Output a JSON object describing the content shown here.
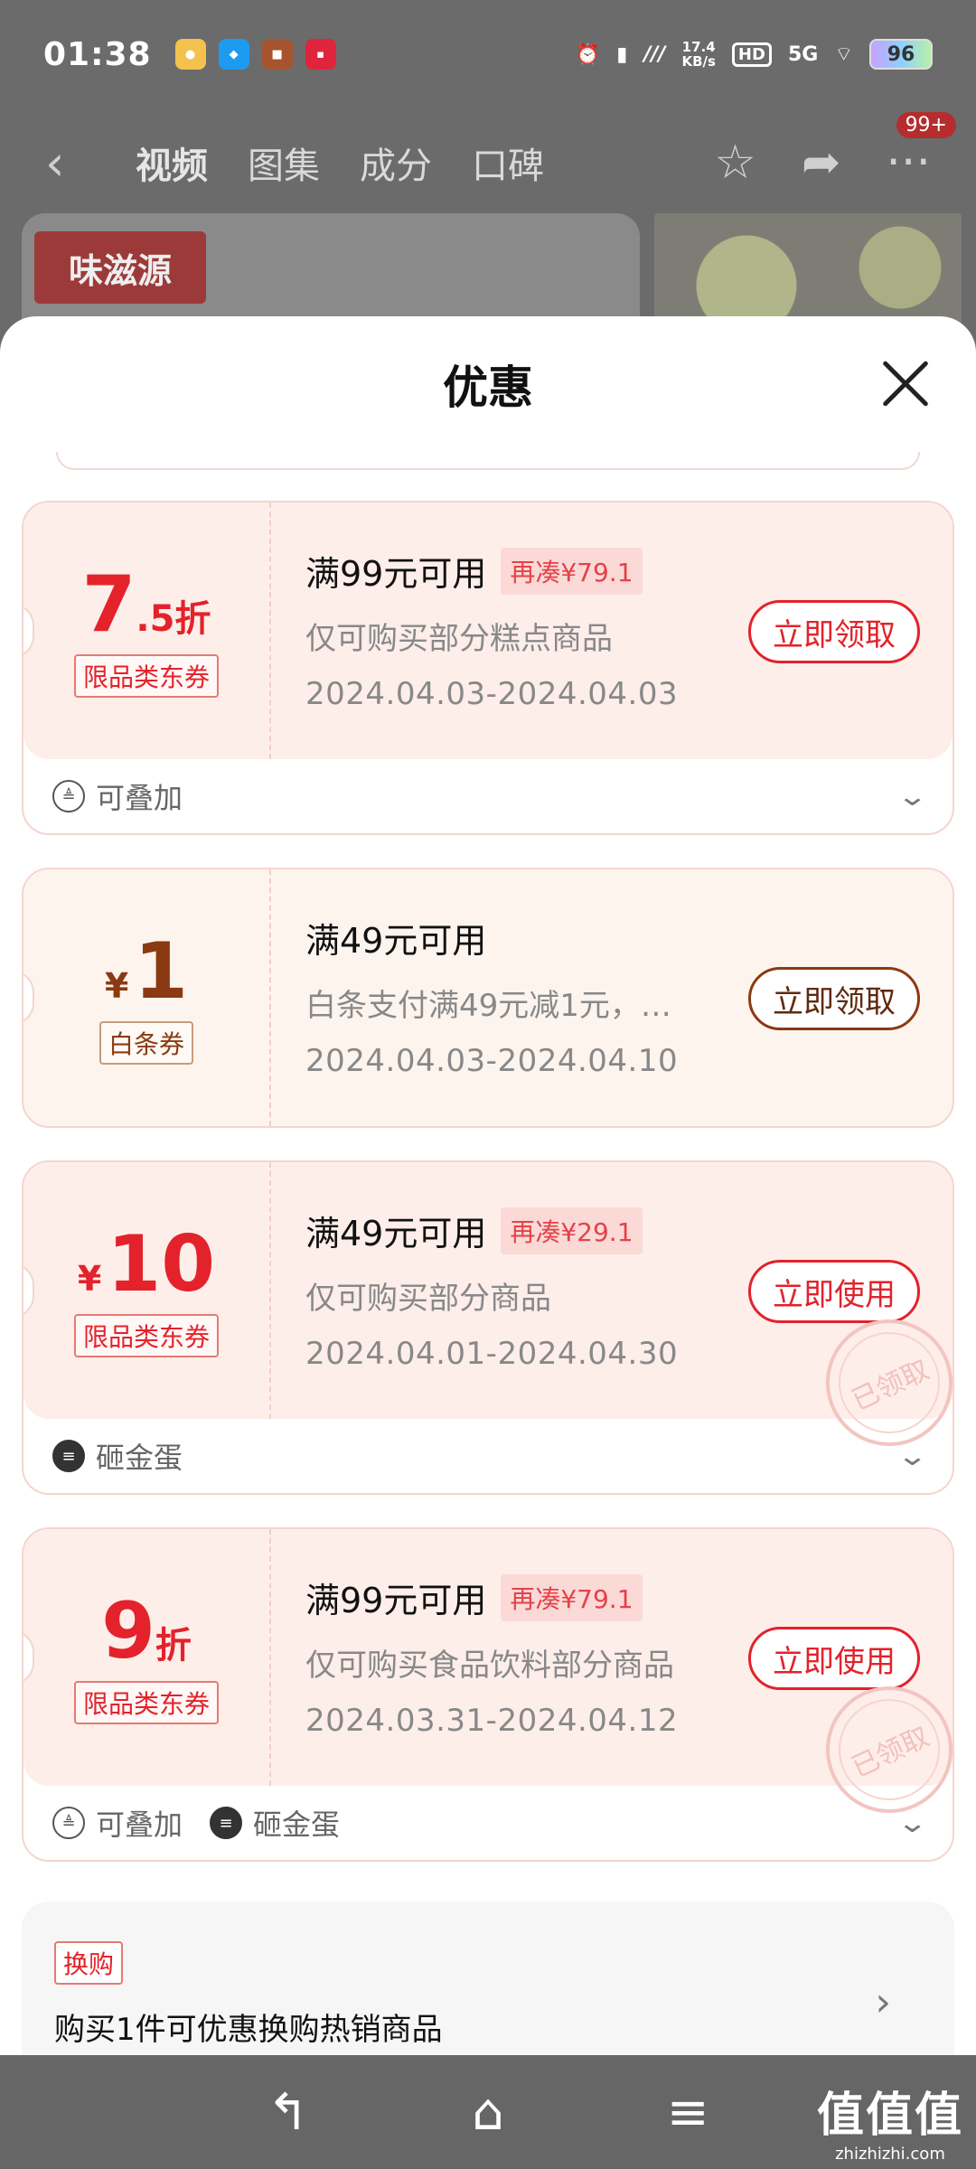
{
  "status_bar": {
    "time": "01:38",
    "speed_top": "17.4",
    "speed_unit": "KB/s",
    "hd": "HD",
    "net": "5G",
    "battery": "96"
  },
  "top_nav": {
    "tabs": [
      "视频",
      "图集",
      "成分",
      "口碑"
    ],
    "badge": "99+"
  },
  "banner": {
    "brand": "味滋源"
  },
  "sheet": {
    "title": "优惠"
  },
  "coupons": [
    {
      "amount_big": "7",
      "amount_small": ".5折",
      "tag": "限品类东券",
      "condition": "满99元可用",
      "extra": "再凑¥79.1",
      "desc": "仅可购买部分糕点商品",
      "date": "2024.04.03-2024.04.03",
      "button": "立即领取",
      "features": [
        "可叠加"
      ]
    },
    {
      "currency": "¥",
      "amount_big": "1",
      "tag": "白条券",
      "condition": "满49元可用",
      "desc": "白条支付满49元减1元，…",
      "date": "2024.04.03-2024.04.10",
      "button": "立即领取"
    },
    {
      "currency": "¥",
      "amount_big": "10",
      "tag": "限品类东券",
      "condition": "满49元可用",
      "extra": "再凑¥29.1",
      "desc": "仅可购买部分商品",
      "date": "2024.04.01-2024.04.30",
      "button": "立即使用",
      "stamp": "已领取",
      "features": [
        "砸金蛋"
      ]
    },
    {
      "amount_big": "9",
      "amount_small": "折",
      "tag": "限品类东券",
      "condition": "满99元可用",
      "extra": "再凑¥79.1",
      "desc": "仅可购买食品饮料部分商品",
      "date": "2024.03.31-2024.04.12",
      "button": "立即使用",
      "stamp": "已领取",
      "features": [
        "可叠加",
        "砸金蛋"
      ]
    }
  ],
  "exchange": {
    "tag": "换购",
    "text": "购买1件可优惠换购热销商品"
  },
  "watermark": {
    "big": "值值值",
    "small": "zhizhizhi.com"
  }
}
